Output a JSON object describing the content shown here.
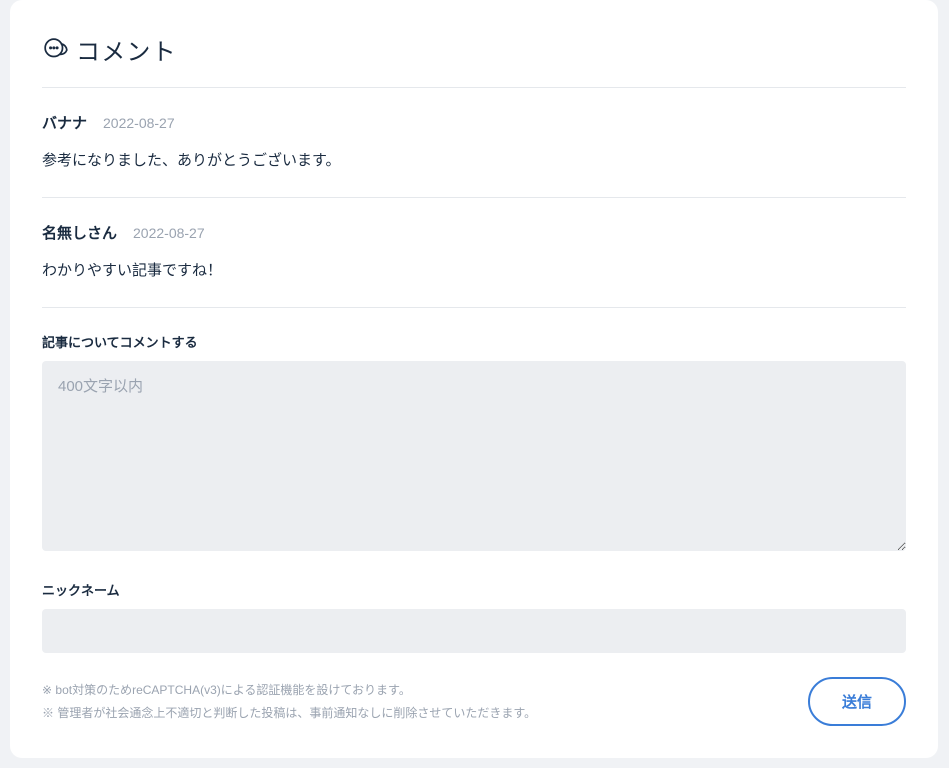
{
  "header": {
    "title": "コメント"
  },
  "comments": [
    {
      "author": "バナナ",
      "date": "2022-08-27",
      "body": "参考になりました、ありがとうございます。"
    },
    {
      "author": "名無しさん",
      "date": "2022-08-27",
      "body": "わかりやすい記事ですね！"
    }
  ],
  "form": {
    "comment_label": "記事についてコメントする",
    "comment_placeholder": "400文字以内",
    "nickname_label": "ニックネーム",
    "submit_label": "送信"
  },
  "notes": {
    "line1": "※ bot対策のためreCAPTCHA(v3)による認証機能を設けております。",
    "line2": "※ 管理者が社会通念上不適切と判断した投稿は、事前通知なしに削除させていただきます。"
  }
}
